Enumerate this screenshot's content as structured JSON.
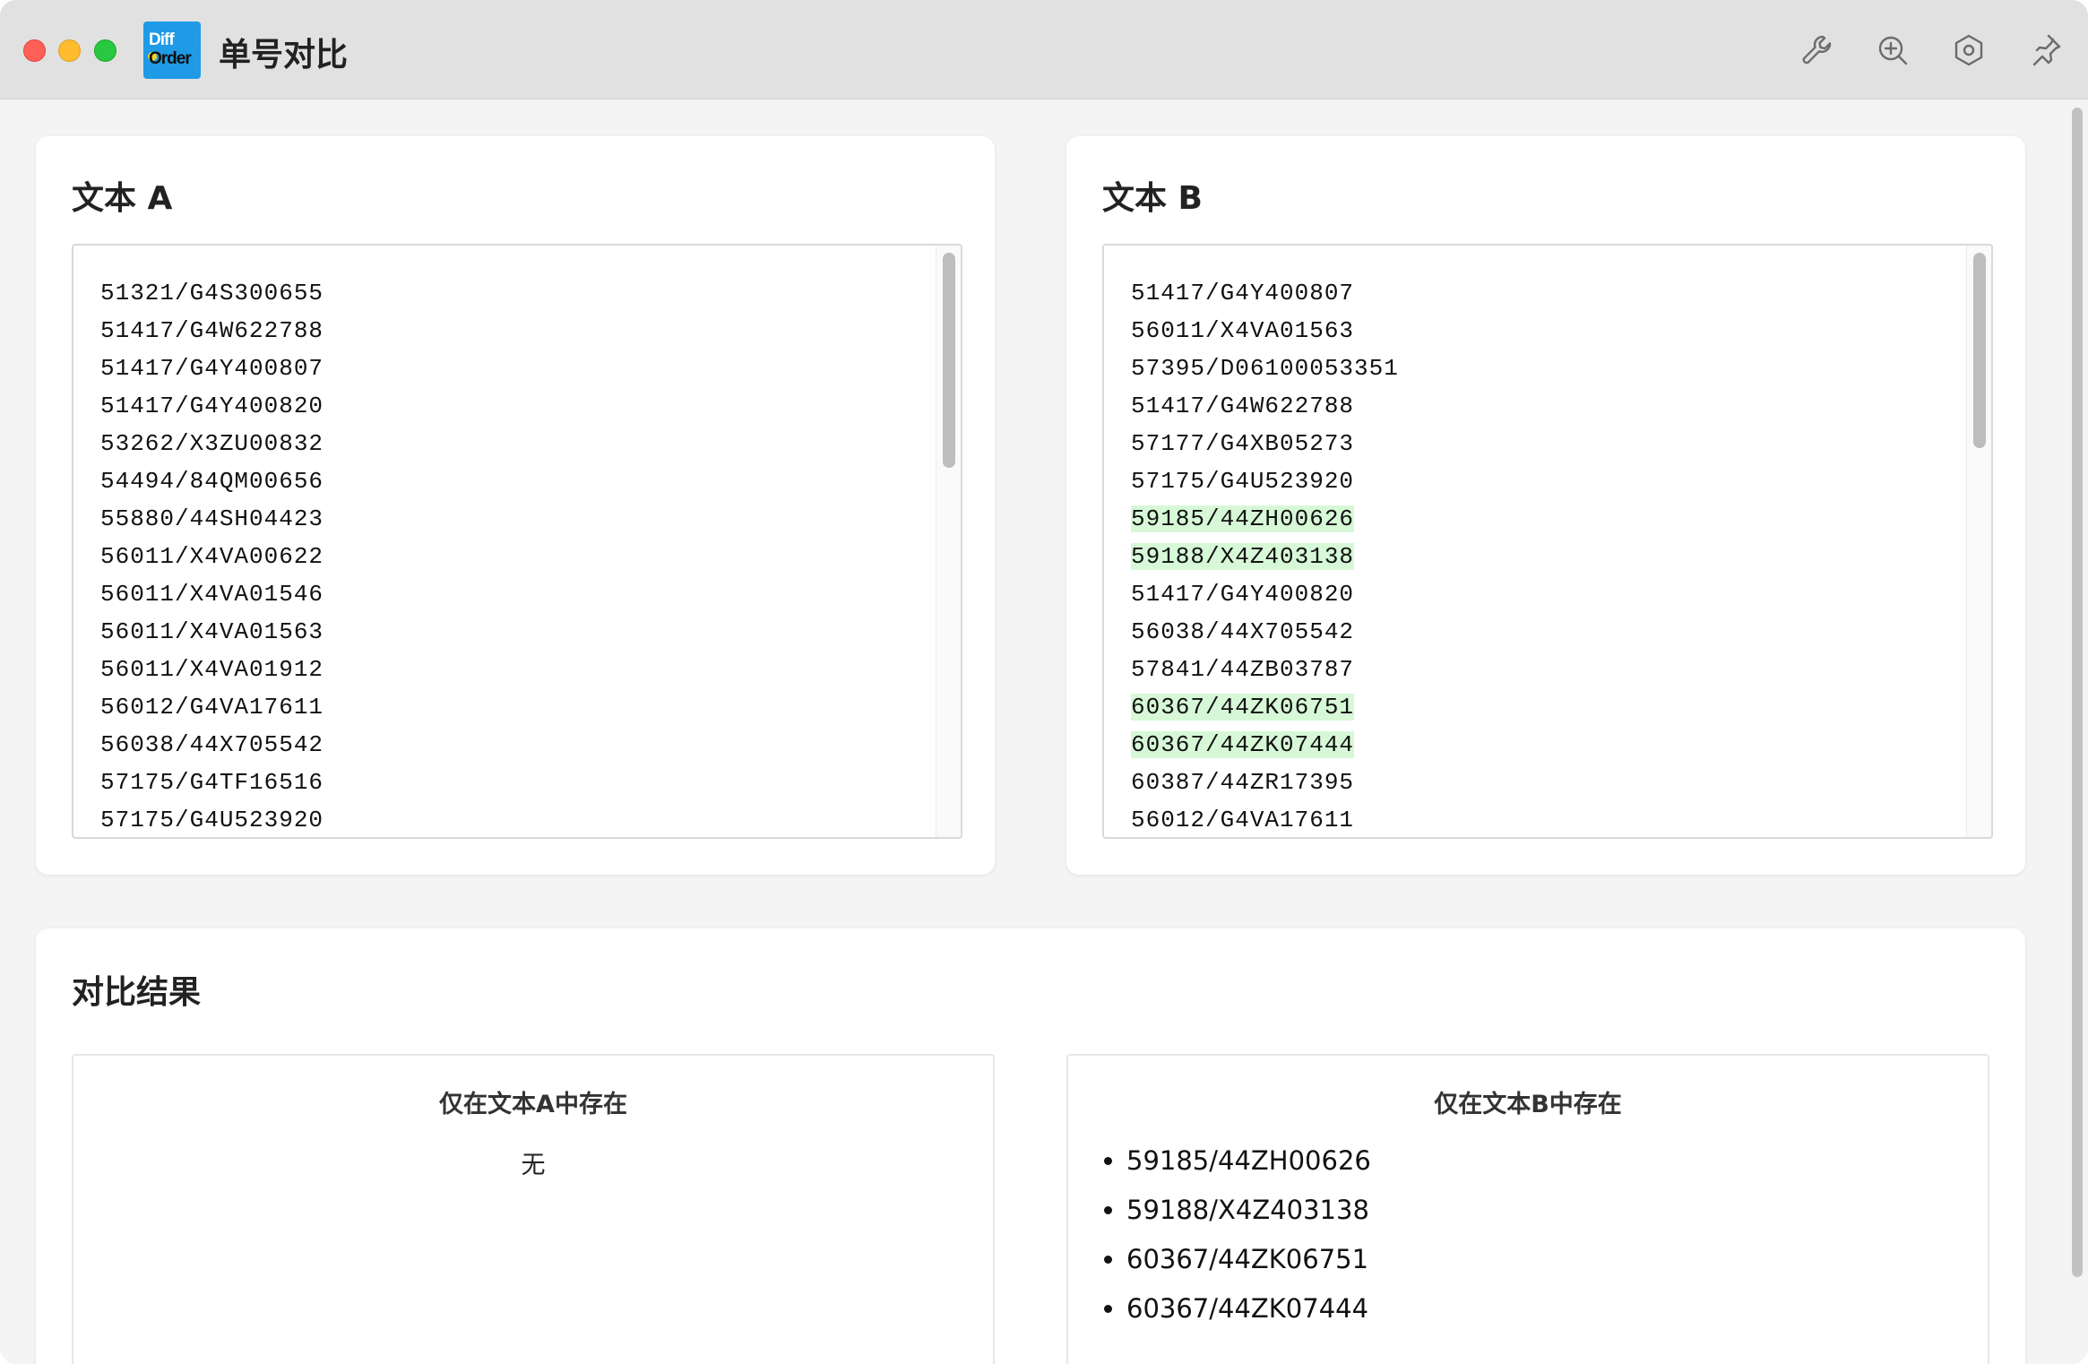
{
  "window": {
    "title": "单号对比",
    "logo_text_top": "Diff",
    "logo_text_bottom": "Order",
    "toolbar_icons": [
      "wrench-icon",
      "zoom-in-icon",
      "settings-hexagon-icon",
      "pin-icon"
    ]
  },
  "text_a": {
    "title": "文本 A",
    "lines": [
      "51321/G4S300655",
      "51417/G4W622788",
      "51417/G4Y400807",
      "51417/G4Y400820",
      "53262/X3ZU00832",
      "54494/84QM00656",
      "55880/44SH04423",
      "56011/X4VA00622",
      "56011/X4VA01546",
      "56011/X4VA01563",
      "56011/X4VA01912",
      "56012/G4VA17611",
      "56038/44X705542",
      "57175/G4TF16516",
      "57175/G4U523920"
    ]
  },
  "text_b": {
    "title": "文本 B",
    "lines": [
      {
        "text": "51417/G4Y400807",
        "highlight": false
      },
      {
        "text": "56011/X4VA01563",
        "highlight": false
      },
      {
        "text": "57395/D06100053351",
        "highlight": false
      },
      {
        "text": "51417/G4W622788",
        "highlight": false
      },
      {
        "text": "57177/G4XB05273",
        "highlight": false
      },
      {
        "text": "57175/G4U523920",
        "highlight": false
      },
      {
        "text": "59185/44ZH00626",
        "highlight": true
      },
      {
        "text": "59188/X4Z403138",
        "highlight": true
      },
      {
        "text": "51417/G4Y400820",
        "highlight": false
      },
      {
        "text": "56038/44X705542",
        "highlight": false
      },
      {
        "text": "57841/44ZB03787",
        "highlight": false
      },
      {
        "text": "60367/44ZK06751",
        "highlight": true
      },
      {
        "text": "60367/44ZK07444",
        "highlight": true
      },
      {
        "text": "60387/44ZR17395",
        "highlight": false
      },
      {
        "text": "56012/G4VA17611",
        "highlight": false
      }
    ],
    "highlight_color": "#d7f8d7"
  },
  "results": {
    "title": "对比结果",
    "only_a": {
      "heading": "仅在文本A中存在",
      "empty_text": "无"
    },
    "only_b": {
      "heading": "仅在文本B中存在",
      "items": [
        "59185/44ZH00626",
        "59188/X4Z403138",
        "60367/44ZK06751",
        "60367/44ZK07444"
      ]
    }
  }
}
